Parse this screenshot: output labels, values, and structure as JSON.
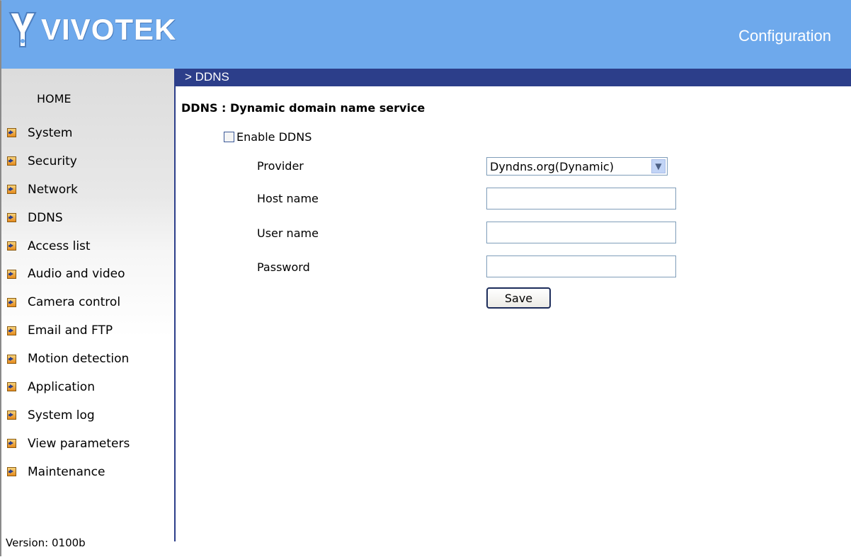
{
  "header": {
    "brand": "VIVOTEK",
    "title": "Configuration"
  },
  "sidebar": {
    "home": "HOME",
    "items": [
      {
        "label": "System"
      },
      {
        "label": "Security"
      },
      {
        "label": "Network"
      },
      {
        "label": "DDNS"
      },
      {
        "label": "Access list"
      },
      {
        "label": "Audio and video"
      },
      {
        "label": "Camera control"
      },
      {
        "label": "Email and FTP"
      },
      {
        "label": "Motion detection"
      },
      {
        "label": "Application"
      },
      {
        "label": "System log"
      },
      {
        "label": "View parameters"
      },
      {
        "label": "Maintenance"
      }
    ],
    "version": "Version: 0100b"
  },
  "breadcrumb": "> DDNS",
  "form": {
    "title": "DDNS : Dynamic domain name service",
    "enable_label": "Enable DDNS",
    "enable_checked": false,
    "provider_label": "Provider",
    "provider_value": "Dyndns.org(Dynamic)",
    "host_label": "Host name",
    "host_value": "",
    "user_label": "User name",
    "user_value": "",
    "password_label": "Password",
    "password_value": "",
    "save_label": "Save"
  },
  "colors": {
    "header_bg": "#6ea9ec",
    "nav_bar": "#2c3e8a"
  }
}
